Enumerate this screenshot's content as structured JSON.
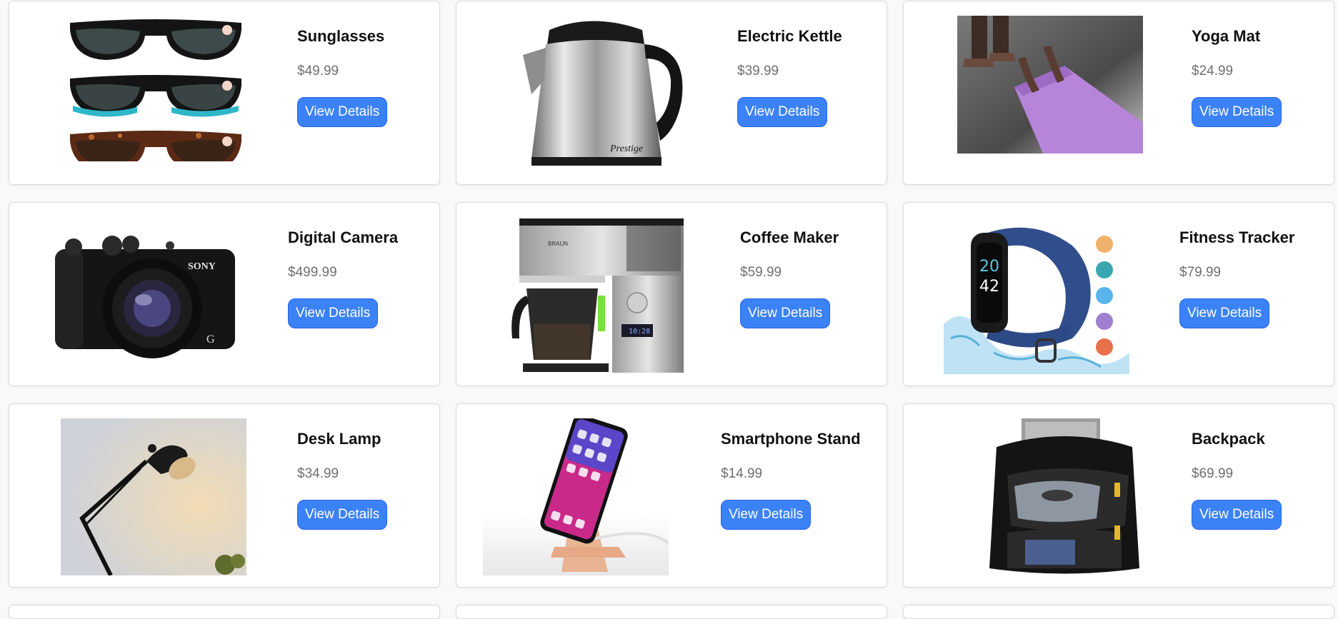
{
  "products": [
    {
      "name": "Sunglasses",
      "price": "$49.99",
      "button": "View Details",
      "image": "sunglasses-image"
    },
    {
      "name": "Electric Kettle",
      "price": "$39.99",
      "button": "View Details",
      "image": "kettle-image",
      "brand": "Prestige"
    },
    {
      "name": "Yoga Mat",
      "price": "$24.99",
      "button": "View Details",
      "image": "yoga-mat-image"
    },
    {
      "name": "Digital Camera",
      "price": "$499.99",
      "button": "View Details",
      "image": "camera-image",
      "brand": "SONY"
    },
    {
      "name": "Coffee Maker",
      "price": "$59.99",
      "button": "View Details",
      "image": "coffee-maker-image",
      "brand": "BRAUN",
      "display": "10:28"
    },
    {
      "name": "Fitness Tracker",
      "price": "$79.99",
      "button": "View Details",
      "image": "fitness-tracker-image",
      "hours": "20",
      "minutes": "42"
    },
    {
      "name": "Desk Lamp",
      "price": "$34.99",
      "button": "View Details",
      "image": "desk-lamp-image"
    },
    {
      "name": "Smartphone Stand",
      "price": "$14.99",
      "button": "View Details",
      "image": "phone-stand-image"
    },
    {
      "name": "Backpack",
      "price": "$69.99",
      "button": "View Details",
      "image": "backpack-image"
    }
  ],
  "colors": {
    "accent": "#3b82f6",
    "price": "#6f6f6f",
    "background": "#f9f9f9"
  }
}
